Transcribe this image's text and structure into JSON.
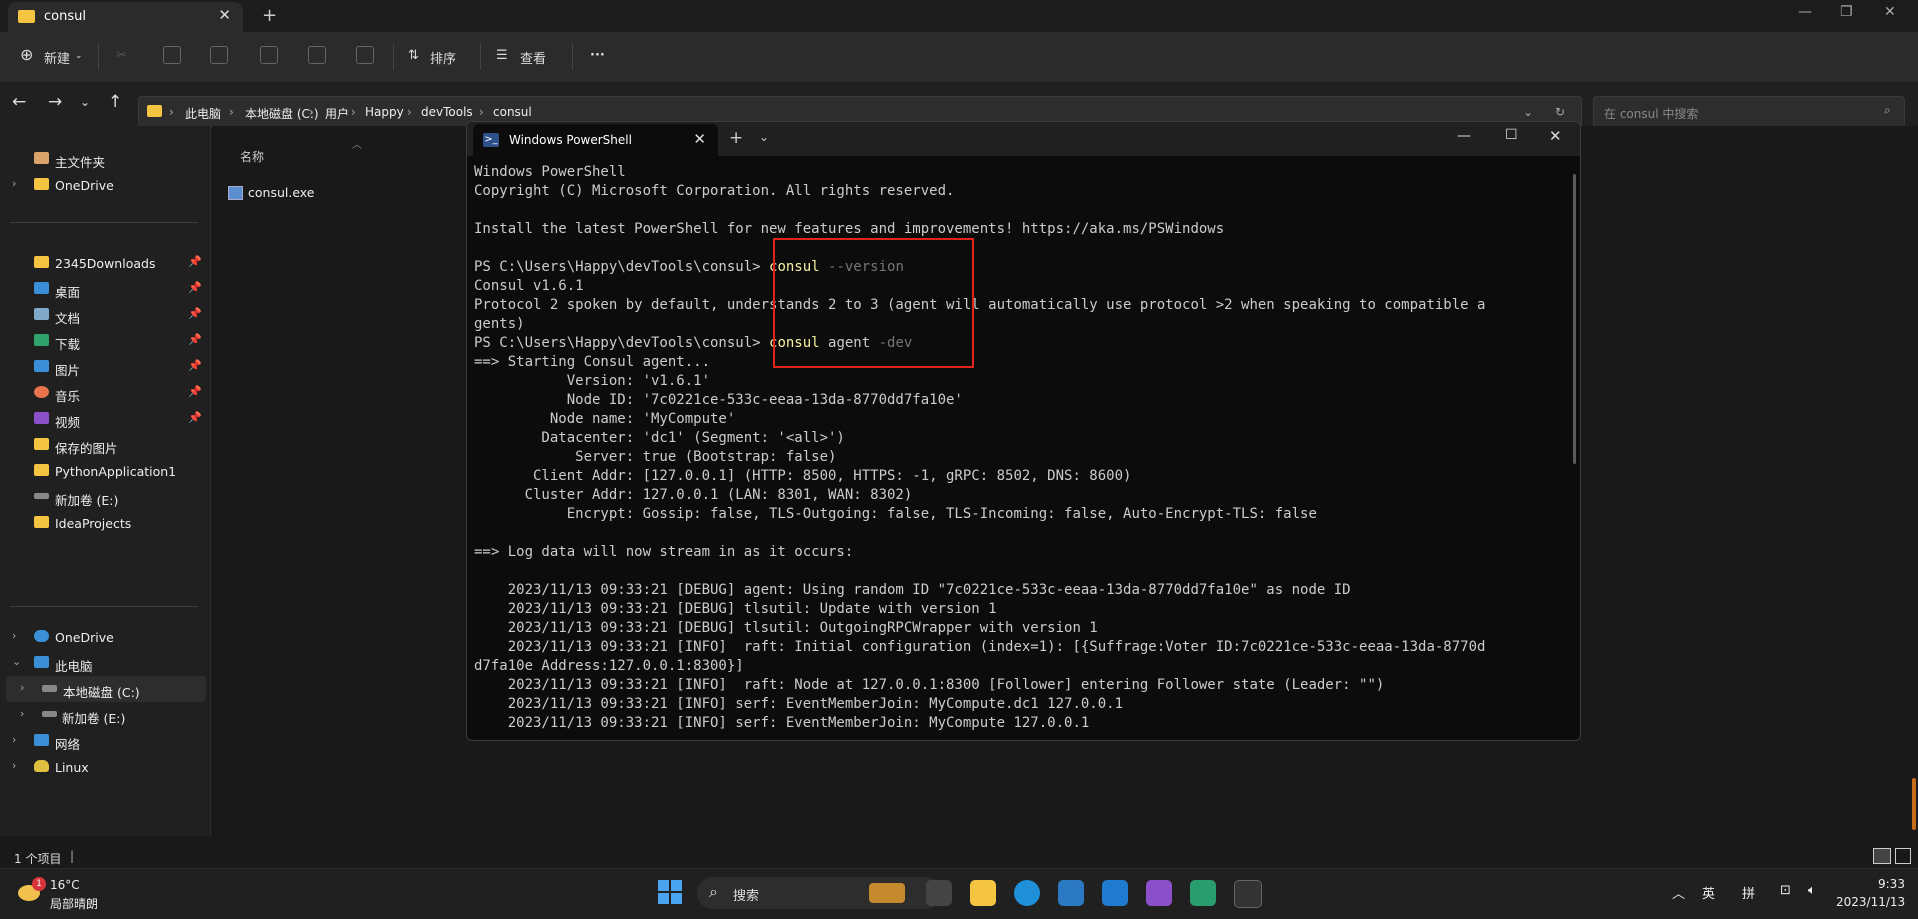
{
  "explorer": {
    "tab_title": "consul",
    "toolbar": {
      "new": "新建",
      "sort": "排序",
      "view": "查看",
      "more": "···"
    },
    "breadcrumb": [
      "此电脑",
      "本地磁盘 (C:)",
      "用户",
      "Happy",
      "devTools",
      "consul"
    ],
    "search_placeholder": "在 consul 中搜索",
    "column_name": "名称",
    "file": "consul.exe",
    "status": "1 个项目",
    "sidebar": [
      {
        "label": "主文件夹",
        "icon": "home-icon"
      },
      {
        "label": "OneDrive",
        "icon": "folder-icon"
      },
      {
        "label": "2345Downloads",
        "icon": "folder-icon",
        "pinned": true
      },
      {
        "label": "桌面",
        "icon": "desktop-icon",
        "pinned": true
      },
      {
        "label": "文档",
        "icon": "document-icon",
        "pinned": true
      },
      {
        "label": "下载",
        "icon": "download-icon",
        "pinned": true
      },
      {
        "label": "图片",
        "icon": "pictures-icon",
        "pinned": true
      },
      {
        "label": "音乐",
        "icon": "music-icon",
        "pinned": true
      },
      {
        "label": "视频",
        "icon": "video-icon",
        "pinned": true
      },
      {
        "label": "保存的图片",
        "icon": "folder-icon"
      },
      {
        "label": "PythonApplication1",
        "icon": "folder-icon"
      },
      {
        "label": "新加卷 (E:)",
        "icon": "drive-icon"
      },
      {
        "label": "IdeaProjects",
        "icon": "folder-icon"
      },
      {
        "label": "OneDrive",
        "icon": "cloud-icon"
      },
      {
        "label": "此电脑",
        "icon": "computer-icon"
      },
      {
        "label": "本地磁盘 (C:)",
        "icon": "drive-icon"
      },
      {
        "label": "新加卷 (E:)",
        "icon": "drive-icon"
      },
      {
        "label": "网络",
        "icon": "network-icon"
      },
      {
        "label": "Linux",
        "icon": "linux-icon"
      }
    ]
  },
  "powershell": {
    "tab_title": "Windows PowerShell",
    "lines": [
      {
        "t": "Windows PowerShell"
      },
      {
        "t": "Copyright (C) Microsoft Corporation. All rights reserved."
      },
      {
        "t": ""
      },
      {
        "t": "Install the latest PowerShell for new features and improvements! https://aka.ms/PSWindows"
      },
      {
        "t": ""
      },
      {
        "prompt": "PS C:\\Users\\Happy\\devTools\\consul> ",
        "cmd": "consul",
        "arg": " --version"
      },
      {
        "t": "Consul v1.6.1"
      },
      {
        "t": "Protocol 2 spoken by default, understands 2 to 3 (agent will automatically use protocol >2 when speaking to compatible a"
      },
      {
        "t": "gents)"
      },
      {
        "prompt": "PS C:\\Users\\Happy\\devTools\\consul> ",
        "cmd": "consul",
        "arg2": " agent",
        "arg": " -dev"
      },
      {
        "t": "==> Starting Consul agent..."
      },
      {
        "t": "           Version: 'v1.6.1'"
      },
      {
        "t": "           Node ID: '7c0221ce-533c-eeaa-13da-8770dd7fa10e'"
      },
      {
        "t": "         Node name: 'MyCompute'"
      },
      {
        "t": "        Datacenter: 'dc1' (Segment: '<all>')"
      },
      {
        "t": "            Server: true (Bootstrap: false)"
      },
      {
        "t": "       Client Addr: [127.0.0.1] (HTTP: 8500, HTTPS: -1, gRPC: 8502, DNS: 8600)"
      },
      {
        "t": "      Cluster Addr: 127.0.0.1 (LAN: 8301, WAN: 8302)"
      },
      {
        "t": "           Encrypt: Gossip: false, TLS-Outgoing: false, TLS-Incoming: false, Auto-Encrypt-TLS: false"
      },
      {
        "t": ""
      },
      {
        "t": "==> Log data will now stream in as it occurs:"
      },
      {
        "t": ""
      },
      {
        "t": "    2023/11/13 09:33:21 [DEBUG] agent: Using random ID \"7c0221ce-533c-eeaa-13da-8770dd7fa10e\" as node ID"
      },
      {
        "t": "    2023/11/13 09:33:21 [DEBUG] tlsutil: Update with version 1"
      },
      {
        "t": "    2023/11/13 09:33:21 [DEBUG] tlsutil: OutgoingRPCWrapper with version 1"
      },
      {
        "t": "    2023/11/13 09:33:21 [INFO]  raft: Initial configuration (index=1): [{Suffrage:Voter ID:7c0221ce-533c-eeaa-13da-8770d"
      },
      {
        "t": "d7fa10e Address:127.0.0.1:8300}]"
      },
      {
        "t": "    2023/11/13 09:33:21 [INFO]  raft: Node at 127.0.0.1:8300 [Follower] entering Follower state (Leader: \"\")"
      },
      {
        "t": "    2023/11/13 09:33:21 [INFO] serf: EventMemberJoin: MyCompute.dc1 127.0.0.1"
      },
      {
        "t": "    2023/11/13 09:33:21 [INFO] serf: EventMemberJoin: MyCompute 127.0.0.1"
      }
    ]
  },
  "taskbar": {
    "weather_temp": "16°C",
    "weather_desc": "局部晴朗",
    "weather_badge": "1",
    "search": "搜索",
    "ime1": "英",
    "ime2": "拼",
    "time": "9:33",
    "date": "2023/11/13"
  },
  "colors": {
    "highlight": "#e0241c",
    "folder": "#f5c542",
    "cmd": "#f9f1a5"
  }
}
